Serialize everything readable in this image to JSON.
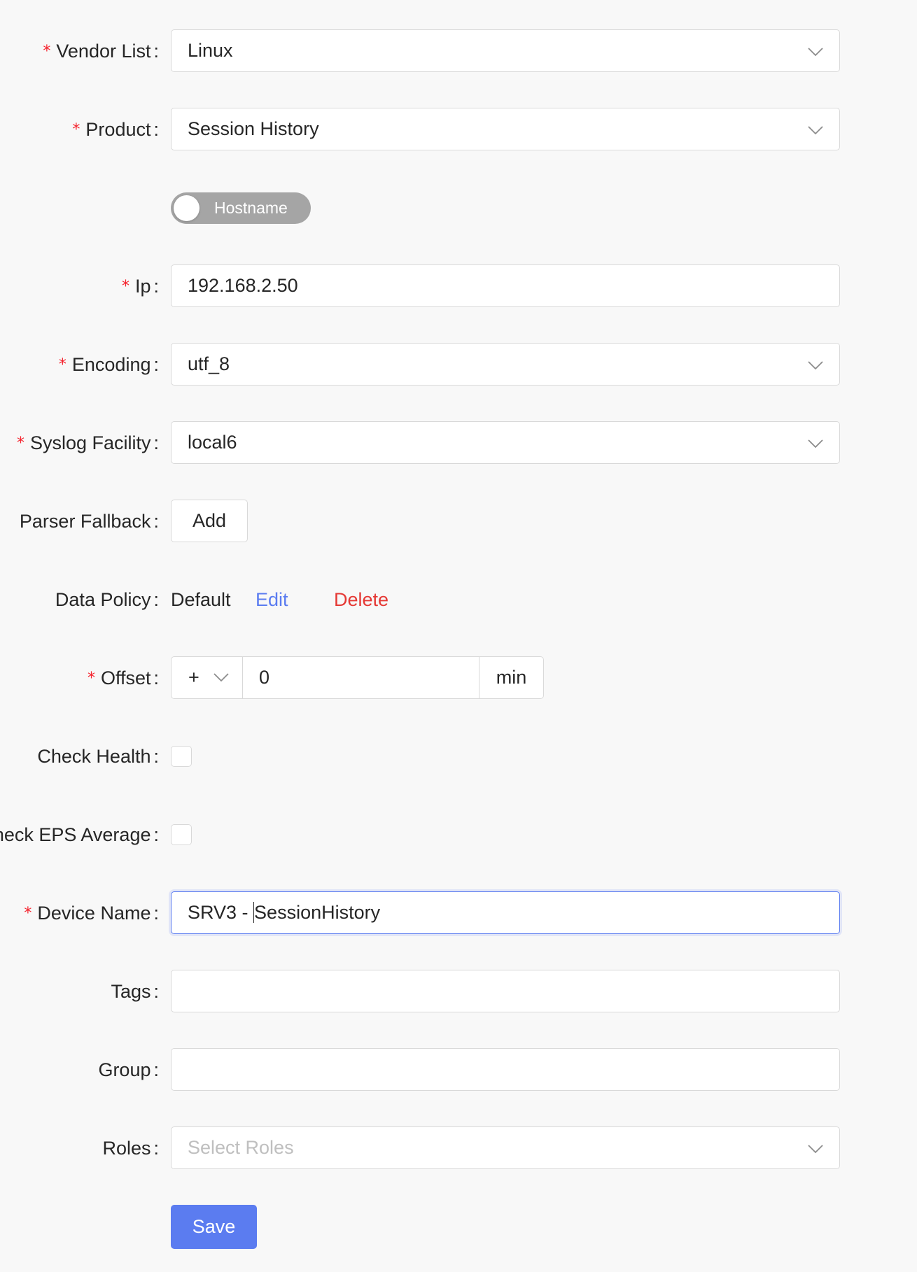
{
  "required_marker": "*",
  "colon": ":",
  "form": {
    "vendor_list": {
      "label": "Vendor List",
      "value": "Linux"
    },
    "product": {
      "label": "Product",
      "value": "Session History"
    },
    "hostname_toggle": {
      "label": "Hostname",
      "checked": false
    },
    "ip": {
      "label": "Ip",
      "value": "192.168.2.50"
    },
    "encoding": {
      "label": "Encoding",
      "value": "utf_8"
    },
    "syslog_facility": {
      "label": "Syslog Facility",
      "value": "local6"
    },
    "parser_fallback": {
      "label": "Parser Fallback",
      "button": "Add"
    },
    "data_policy": {
      "label": "Data Policy",
      "value": "Default",
      "edit": "Edit",
      "delete": "Delete"
    },
    "offset": {
      "label": "Offset",
      "sign": "+",
      "value": "0",
      "unit": "min"
    },
    "check_health": {
      "label": "Check Health",
      "checked": false
    },
    "check_eps_average": {
      "label": "heck EPS Average",
      "checked": false
    },
    "device_name": {
      "label": "Device Name",
      "value_before_cursor": "SRV3 - ",
      "value_after_cursor": "SessionHistory"
    },
    "tags": {
      "label": "Tags",
      "value": ""
    },
    "group": {
      "label": "Group",
      "value": ""
    },
    "roles": {
      "label": "Roles",
      "placeholder": "Select Roles"
    },
    "save": "Save"
  },
  "colors": {
    "primary": "#5b7cf0",
    "danger": "#e53935",
    "link": "#5b7cf0",
    "required": "#f5222d",
    "toggle_off": "#a5a5a5"
  },
  "icons": {
    "dropdown": "chevron-down-icon"
  }
}
